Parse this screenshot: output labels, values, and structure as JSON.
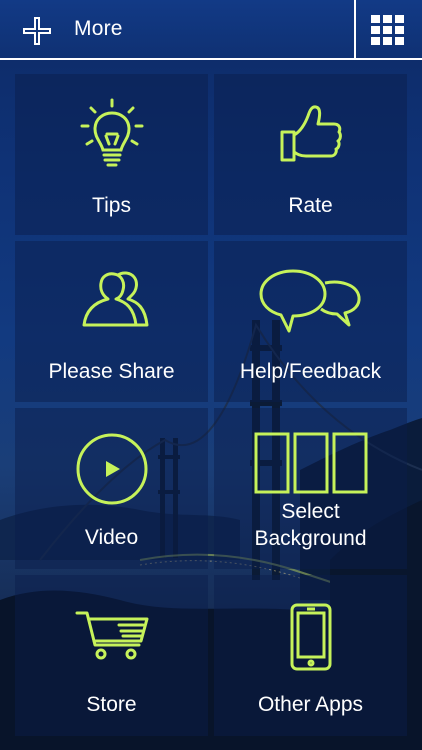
{
  "header": {
    "more_label": "More",
    "add_icon": "plus-icon",
    "grid_icon": "grid-menu-icon"
  },
  "tiles": [
    {
      "label": "Tips",
      "icon": "lightbulb-icon"
    },
    {
      "label": "Rate",
      "icon": "thumbs-up-icon"
    },
    {
      "label": "Please Share",
      "icon": "people-icon"
    },
    {
      "label": "Help/Feedback",
      "icon": "speech-bubbles-icon"
    },
    {
      "label": "Video",
      "icon": "play-circle-icon"
    },
    {
      "label": "Select Background",
      "label_line1": "Select",
      "label_line2": "Background",
      "icon": "background-panels-icon"
    },
    {
      "label": "Store",
      "icon": "shopping-cart-icon"
    },
    {
      "label": "Other Apps",
      "icon": "smartphone-icon"
    }
  ],
  "colors": {
    "accent": "#c6f25a",
    "background": "#0f3276",
    "text": "#ffffff"
  }
}
